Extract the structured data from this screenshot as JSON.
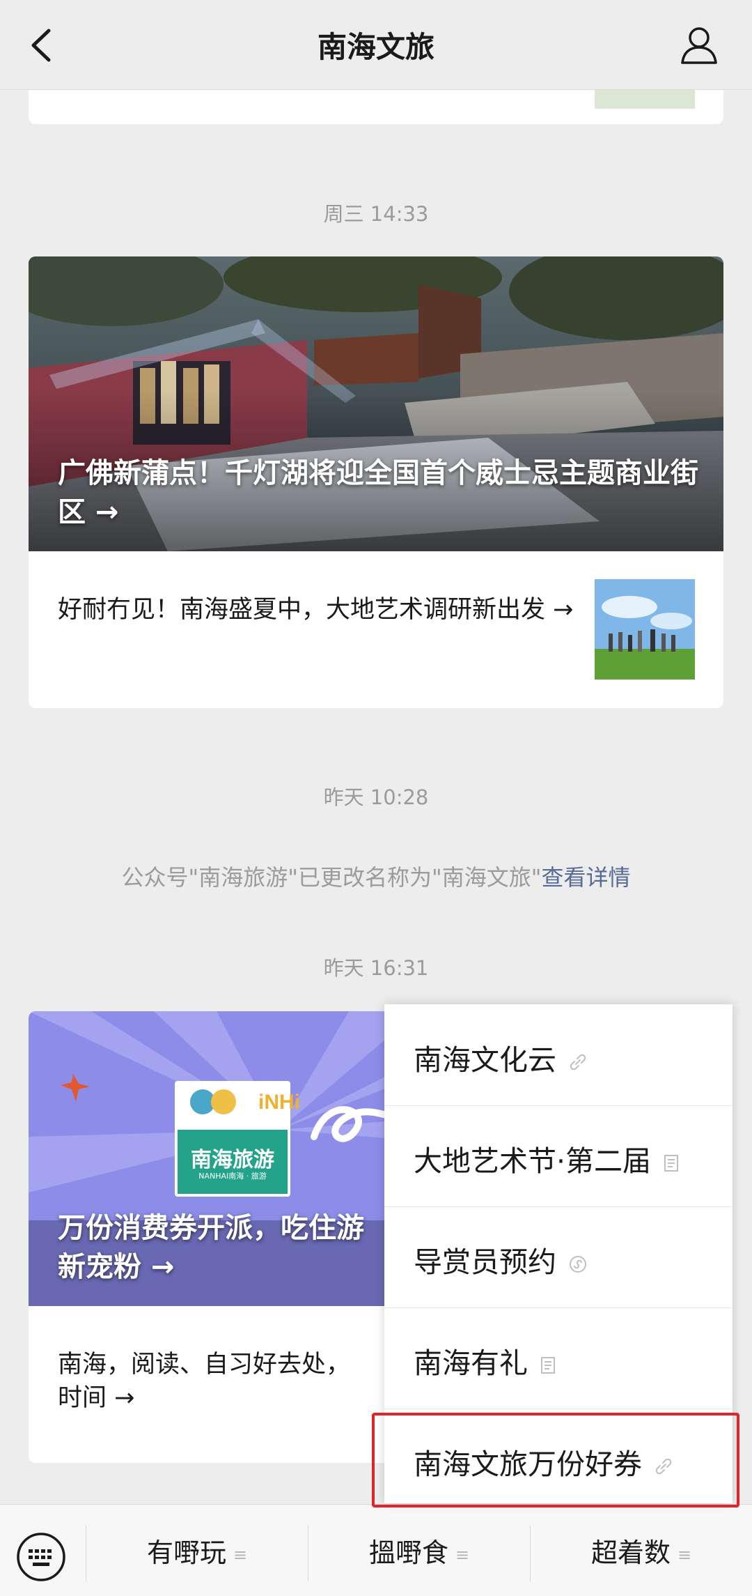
{
  "header": {
    "title": "南海文旅"
  },
  "timestamps": {
    "t1": "周三 14:33",
    "t2": "昨天 10:28",
    "t3": "昨天 16:31"
  },
  "article1": {
    "title": "广佛新蒲点！千灯湖将迎全国首个威士忌主题商业街区 →",
    "sub_title": "好耐冇见！南海盛夏中，大地艺术调研新出发 →"
  },
  "system_message": {
    "text": "公众号\"南海旅游\"已更改名称为\"南海文旅\"",
    "link": "查看详情"
  },
  "article2": {
    "logo_line1": "南海旅游",
    "logo_line2": "NANHAI南海 · 旅游",
    "title": "万份消费券开派，吃住游",
    "title_line2": "新宠粉 →",
    "sub_line1": "南海，阅读、自习好去处，",
    "sub_line2": "时间 →"
  },
  "popup_menu": {
    "items": [
      {
        "label": "南海文化云",
        "icon": "link-icon"
      },
      {
        "label": "大地艺术节·第二届",
        "icon": "article-icon"
      },
      {
        "label": "导赏员预约",
        "icon": "miniprogram-icon"
      },
      {
        "label": "南海有礼",
        "icon": "article-icon"
      },
      {
        "label": "南海文旅万份好券",
        "icon": "link-icon"
      }
    ]
  },
  "bottom_menu": {
    "items": [
      {
        "label": "有嘢玩",
        "icon": "≡"
      },
      {
        "label": "搵嘢食",
        "icon": "≡"
      },
      {
        "label": "超着数",
        "icon": "≡"
      }
    ]
  },
  "colors": {
    "background": "#ededed",
    "link": "#576b95",
    "highlight": "#e0242a"
  }
}
